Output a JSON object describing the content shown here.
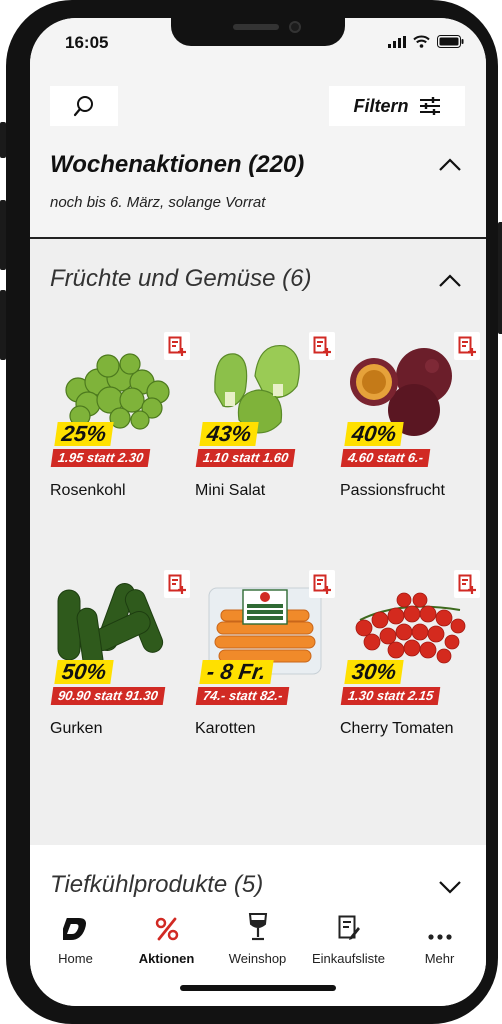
{
  "status": {
    "time": "16:05"
  },
  "colors": {
    "brand_red": "#d12a24",
    "badge_yellow": "#ffe000",
    "background": "#efefef"
  },
  "toolbar": {
    "search_icon": "search-icon",
    "filter_label": "Filtern"
  },
  "promo": {
    "title": "Wochenaktionen (220)",
    "subtitle": "noch bis 6. März, solange Vorrat"
  },
  "categories": [
    {
      "title": "Früchte und Gemüse (6)",
      "expanded": true,
      "products": [
        {
          "name": "Rosenkohl",
          "discount": "25%",
          "price": "1.95 statt 2.30",
          "icon": "brussels-sprouts"
        },
        {
          "name": "Mini Salat",
          "discount": "43%",
          "price": "1.10 statt 1.60",
          "icon": "lettuce"
        },
        {
          "name": "Passionsfrucht",
          "discount": "40%",
          "price": "4.60 statt 6.-",
          "icon": "passion-fruit"
        },
        {
          "name": "Gurken",
          "discount": "50%",
          "price": "90.90 statt 91.30",
          "icon": "cucumbers"
        },
        {
          "name": "Karotten",
          "discount": "- 8 Fr.",
          "price": "74.- statt 82.-",
          "icon": "carrots-bag"
        },
        {
          "name": "Cherry Tomaten",
          "discount": "30%",
          "price": "1.30 statt 2.15",
          "icon": "cherry-tomatoes"
        }
      ]
    },
    {
      "title": "Tiefkühlprodukte (5)",
      "expanded": false
    }
  ],
  "tabs": [
    {
      "label": "Home",
      "icon": "home-logo-icon",
      "active": false
    },
    {
      "label": "Aktionen",
      "icon": "percent-icon",
      "active": true
    },
    {
      "label": "Weinshop",
      "icon": "wine-glass-icon",
      "active": false
    },
    {
      "label": "Einkaufsliste",
      "icon": "shopping-list-icon",
      "active": false
    },
    {
      "label": "Mehr",
      "icon": "more-icon",
      "active": false
    }
  ]
}
